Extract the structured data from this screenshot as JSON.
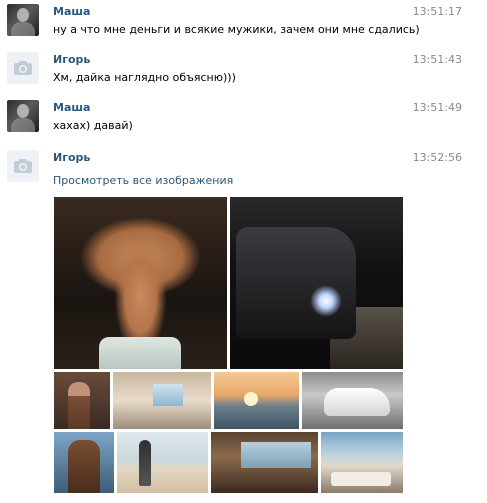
{
  "messages": [
    {
      "author": "Маша",
      "time": "13:51:17",
      "text": "ну а что мне деньги и всякие мужики, зачем они мне сдались)",
      "avatar": "photo"
    },
    {
      "author": "Игорь",
      "time": "13:51:43",
      "text": "Хм, дайка наглядно объясню)))",
      "avatar": "camera-icon"
    },
    {
      "author": "Маша",
      "time": "13:51:49",
      "text": "хахах) давай)",
      "avatar": "photo"
    },
    {
      "author": "Игорь",
      "time": "13:52:56",
      "link": "Просмотреть все изображения",
      "avatar": "camera-icon"
    }
  ],
  "colors": {
    "author": "#2b587a",
    "time": "#8a8a8a",
    "link": "#2b587a",
    "text": "#000000",
    "avatar_placeholder": "#eef1f5"
  },
  "attachments": [
    "photo-abs",
    "photo-car-night",
    "photo-man-suit",
    "photo-room-interior",
    "photo-sunset-sea",
    "photo-white-mercedes",
    "photo-muscle-man",
    "photo-girl-beach",
    "photo-room-panorama",
    "photo-room-sea-view"
  ]
}
